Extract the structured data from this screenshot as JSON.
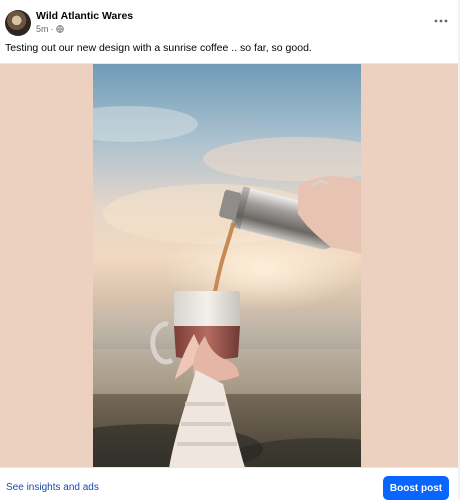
{
  "post": {
    "page_name": "Wild Atlantic Wares",
    "time": "5m",
    "separator": "·",
    "audience_icon": "globe-icon",
    "more_icon": "more-options-icon",
    "caption": "Testing out our new design with a sunrise coffee .. so far, so good.",
    "photo_alt": "Hand holding a two-tone mug as coffee is poured from a steel flask at sunrise",
    "colors": {
      "media_background": "#ecd1c0",
      "boost": "#0866ff",
      "link": "#1b4aa8"
    }
  },
  "footer": {
    "insights_label": "See insights and ads",
    "boost_label": "Boost post"
  }
}
